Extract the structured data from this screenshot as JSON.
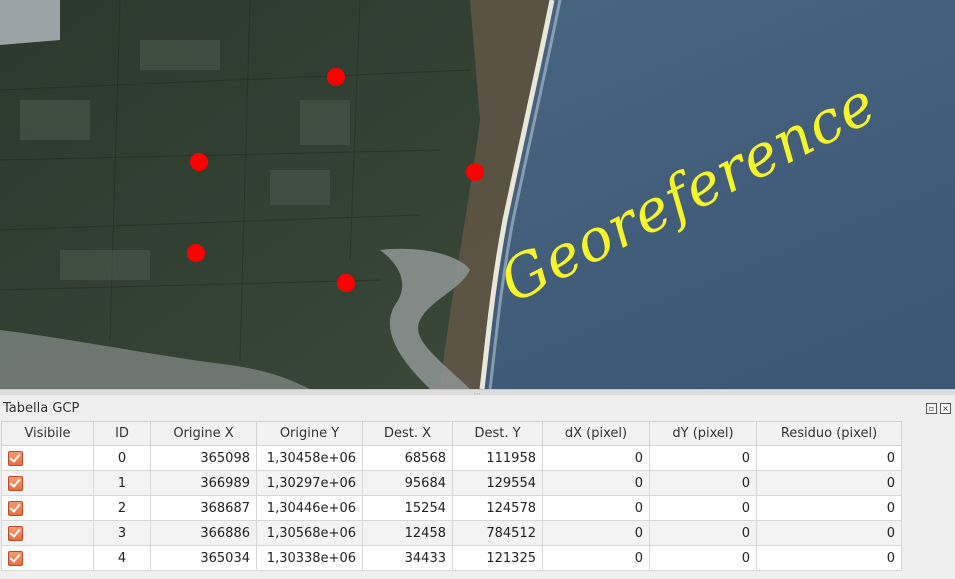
{
  "map": {
    "overlay_text": "Georeference",
    "overlay_color": "#f5f52a",
    "gcp_color": "#ff0000"
  },
  "panel": {
    "title": "Tabella GCP"
  },
  "table": {
    "headers": [
      "Visibile",
      "ID",
      "Origine X",
      "Origine Y",
      "Dest. X",
      "Dest. Y",
      "dX (pixel)",
      "dY (pixel)",
      "Residuo (pixel)"
    ],
    "rows": [
      {
        "visible": true,
        "id": "0",
        "orig_x": "365098",
        "orig_y": "1,30458e+06",
        "dest_x": "68568",
        "dest_y": "111958",
        "dx": "0",
        "dy": "0",
        "residual": "0"
      },
      {
        "visible": true,
        "id": "1",
        "orig_x": "366989",
        "orig_y": "1,30297e+06",
        "dest_x": "95684",
        "dest_y": "129554",
        "dx": "0",
        "dy": "0",
        "residual": "0"
      },
      {
        "visible": true,
        "id": "2",
        "orig_x": "368687",
        "orig_y": "1,30446e+06",
        "dest_x": "15254",
        "dest_y": "124578",
        "dx": "0",
        "dy": "0",
        "residual": "0"
      },
      {
        "visible": true,
        "id": "3",
        "orig_x": "366886",
        "orig_y": "1,30568e+06",
        "dest_x": "12458",
        "dest_y": "784512",
        "dx": "0",
        "dy": "0",
        "residual": "0"
      },
      {
        "visible": true,
        "id": "4",
        "orig_x": "365034",
        "orig_y": "1,30338e+06",
        "dest_x": "34433",
        "dest_y": "121325",
        "dx": "0",
        "dy": "0",
        "residual": "0"
      }
    ]
  }
}
